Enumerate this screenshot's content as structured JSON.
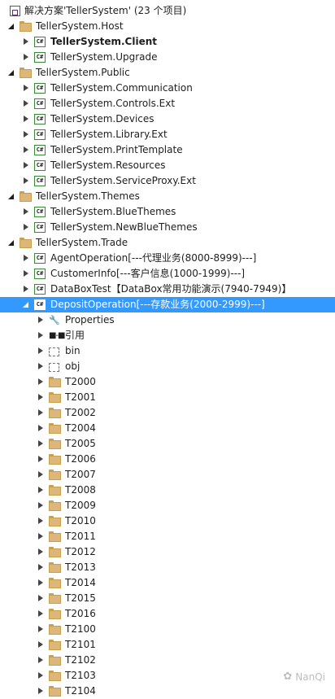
{
  "solution": {
    "label": "解决方案'TellerSystem' (23 个项目)"
  },
  "rows": [
    {
      "label": "TellerSystem.Host",
      "icon": "folder",
      "indent": 1,
      "expander": "expanded"
    },
    {
      "label": "TellerSystem.Client",
      "icon": "csharp-project",
      "indent": 2,
      "expander": "collapsed",
      "bold": true
    },
    {
      "label": "TellerSystem.Upgrade",
      "icon": "csharp-project",
      "indent": 2,
      "expander": "collapsed"
    },
    {
      "label": "TellerSystem.Public",
      "icon": "folder",
      "indent": 1,
      "expander": "expanded"
    },
    {
      "label": "TellerSystem.Communication",
      "icon": "csharp-project",
      "indent": 2,
      "expander": "collapsed"
    },
    {
      "label": "TellerSystem.Controls.Ext",
      "icon": "csharp-project",
      "indent": 2,
      "expander": "collapsed"
    },
    {
      "label": "TellerSystem.Devices",
      "icon": "csharp-project",
      "indent": 2,
      "expander": "collapsed"
    },
    {
      "label": "TellerSystem.Library.Ext",
      "icon": "csharp-project",
      "indent": 2,
      "expander": "collapsed"
    },
    {
      "label": "TellerSystem.PrintTemplate",
      "icon": "csharp-project",
      "indent": 2,
      "expander": "collapsed"
    },
    {
      "label": "TellerSystem.Resources",
      "icon": "csharp-project",
      "indent": 2,
      "expander": "collapsed"
    },
    {
      "label": "TellerSystem.ServiceProxy.Ext",
      "icon": "csharp-project",
      "indent": 2,
      "expander": "collapsed"
    },
    {
      "label": "TellerSystem.Themes",
      "icon": "folder",
      "indent": 1,
      "expander": "expanded"
    },
    {
      "label": "TellerSystem.BlueThemes",
      "icon": "csharp-project",
      "indent": 2,
      "expander": "collapsed"
    },
    {
      "label": "TellerSystem.NewBlueThemes",
      "icon": "csharp-project",
      "indent": 2,
      "expander": "collapsed"
    },
    {
      "label": "TellerSystem.Trade",
      "icon": "folder",
      "indent": 1,
      "expander": "expanded"
    },
    {
      "label": "AgentOperation[---代理业务(8000-8999)---]",
      "icon": "csharp-project",
      "indent": 2,
      "expander": "collapsed"
    },
    {
      "label": "CustomerInfo[---客户信息(1000-1999)---]",
      "icon": "csharp-project",
      "indent": 2,
      "expander": "collapsed"
    },
    {
      "label": "DataBoxTest【DataBox常用功能演示(7940-7949)】",
      "icon": "csharp-project",
      "indent": 2,
      "expander": "collapsed"
    },
    {
      "label": "DepositOperation[---存款业务(2000-2999)---]",
      "icon": "csharp-project",
      "indent": 2,
      "expander": "expanded",
      "selected": true
    },
    {
      "label": "Properties",
      "icon": "wrench",
      "indent": 3,
      "expander": "collapsed"
    },
    {
      "label": "引用",
      "icon": "references",
      "indent": 3,
      "expander": "collapsed"
    },
    {
      "label": "bin",
      "icon": "dashed-folder",
      "indent": 3,
      "expander": "collapsed"
    },
    {
      "label": "obj",
      "icon": "dashed-folder",
      "indent": 3,
      "expander": "collapsed"
    },
    {
      "label": "T2000",
      "icon": "folder",
      "indent": 3,
      "expander": "collapsed"
    },
    {
      "label": "T2001",
      "icon": "folder",
      "indent": 3,
      "expander": "collapsed"
    },
    {
      "label": "T2002",
      "icon": "folder",
      "indent": 3,
      "expander": "collapsed"
    },
    {
      "label": "T2004",
      "icon": "folder",
      "indent": 3,
      "expander": "collapsed"
    },
    {
      "label": "T2005",
      "icon": "folder",
      "indent": 3,
      "expander": "collapsed"
    },
    {
      "label": "T2006",
      "icon": "folder",
      "indent": 3,
      "expander": "collapsed"
    },
    {
      "label": "T2007",
      "icon": "folder",
      "indent": 3,
      "expander": "collapsed"
    },
    {
      "label": "T2008",
      "icon": "folder",
      "indent": 3,
      "expander": "collapsed"
    },
    {
      "label": "T2009",
      "icon": "folder",
      "indent": 3,
      "expander": "collapsed"
    },
    {
      "label": "T2010",
      "icon": "folder",
      "indent": 3,
      "expander": "collapsed"
    },
    {
      "label": "T2011",
      "icon": "folder",
      "indent": 3,
      "expander": "collapsed"
    },
    {
      "label": "T2012",
      "icon": "folder",
      "indent": 3,
      "expander": "collapsed"
    },
    {
      "label": "T2013",
      "icon": "folder",
      "indent": 3,
      "expander": "collapsed"
    },
    {
      "label": "T2014",
      "icon": "folder",
      "indent": 3,
      "expander": "collapsed"
    },
    {
      "label": "T2015",
      "icon": "folder",
      "indent": 3,
      "expander": "collapsed"
    },
    {
      "label": "T2016",
      "icon": "folder",
      "indent": 3,
      "expander": "collapsed"
    },
    {
      "label": "T2100",
      "icon": "folder",
      "indent": 3,
      "expander": "collapsed"
    },
    {
      "label": "T2101",
      "icon": "folder",
      "indent": 3,
      "expander": "collapsed"
    },
    {
      "label": "T2102",
      "icon": "folder",
      "indent": 3,
      "expander": "collapsed"
    },
    {
      "label": "T2103",
      "icon": "folder",
      "indent": 3,
      "expander": "collapsed"
    },
    {
      "label": "T2104",
      "icon": "folder",
      "indent": 3,
      "expander": "collapsed"
    }
  ],
  "watermark": {
    "text": "NanQi"
  },
  "colors": {
    "selection": "#3399ff",
    "folder": "#dcb67a",
    "csharp_border": "#388a34"
  }
}
